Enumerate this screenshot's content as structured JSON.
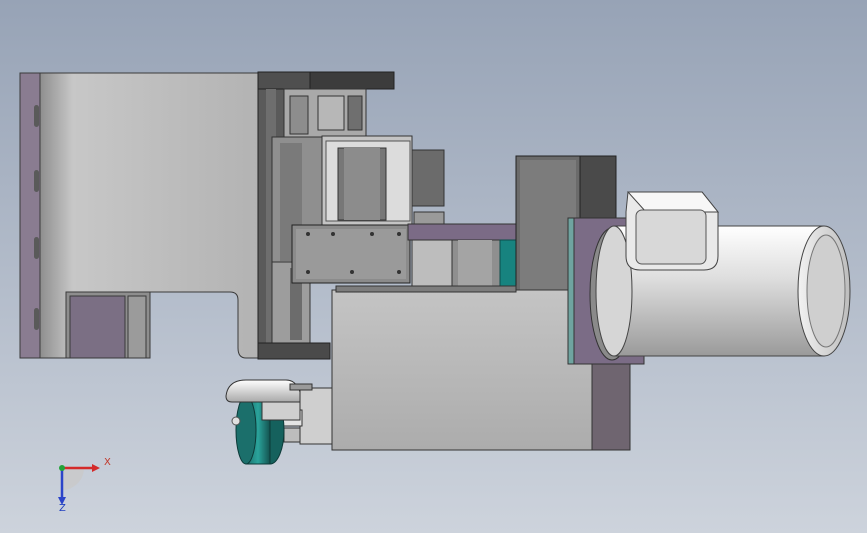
{
  "viewport": {
    "background_top": "#97a3b6",
    "background_bottom": "#cdd3dc"
  },
  "model": {
    "description_components": [
      "mounting-plate",
      "linear-slide",
      "spindle-housing",
      "grinding-wheel",
      "wheel-guard",
      "electric-motor",
      "stepper-motor"
    ],
    "colors": {
      "steel": "#b9b9b9",
      "dark_steel": "#606060",
      "purple_plate": "#7d6f86",
      "teal": "#1c8a86",
      "motor_white": "#e6e6e6"
    }
  },
  "triad": {
    "x_label": "X",
    "z_label": "Z",
    "x_color": "#d42a2a",
    "z_color": "#2b44c9",
    "y_color": "#22a33a"
  }
}
